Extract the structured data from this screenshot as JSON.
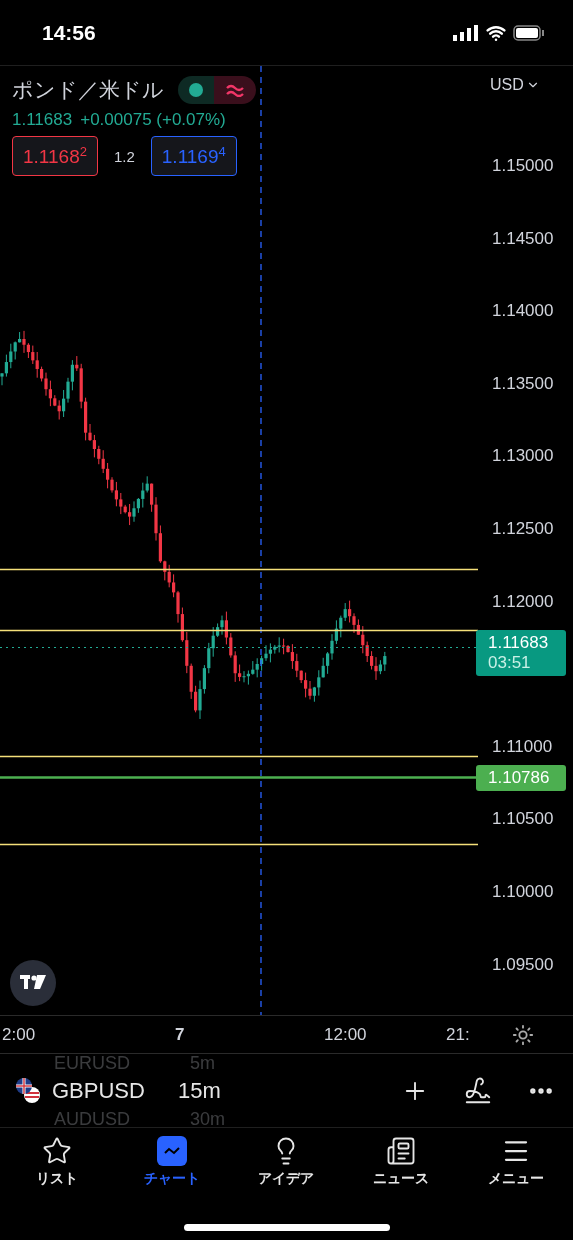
{
  "status_bar": {
    "time": "14:56"
  },
  "symbol_header": {
    "name": "ポンド／米ドル",
    "market_open": true,
    "last": "1.11683",
    "change": "+0.00075 (+0.07%)",
    "sell": "1.1168$^{2}$",
    "spread": "1.2",
    "buy": "1.1169$^{4}$"
  },
  "currency": "USD",
  "price_axis": [
    "1.15000",
    "1.14500",
    "1.14000",
    "1.13500",
    "1.13000",
    "1.12500",
    "1.12000",
    "1.11000",
    "1.10500",
    "1.10000",
    "1.09500"
  ],
  "last_badge": {
    "price": "1.11683",
    "countdown": "03:51"
  },
  "alert_badge": {
    "price": "1.10786"
  },
  "time_axis": [
    {
      "label": "2:00",
      "kind": "time"
    },
    {
      "label": "7",
      "kind": "day"
    },
    {
      "label": "12:00",
      "kind": "time"
    },
    {
      "label": "21:",
      "kind": "time"
    }
  ],
  "symbol_bar": {
    "above": {
      "symbol": "EURUSD",
      "interval": "5m"
    },
    "current": {
      "symbol": "GBPUSD",
      "interval": "15m"
    },
    "below": {
      "symbol": "AUDUSD",
      "interval": "30m"
    }
  },
  "tabs": [
    {
      "label": "リスト",
      "selected": false
    },
    {
      "label": "チャート",
      "selected": true
    },
    {
      "label": "アイデア",
      "selected": false
    },
    {
      "label": "ニュース",
      "selected": false
    },
    {
      "label": "メニュー",
      "selected": false
    }
  ]
}
